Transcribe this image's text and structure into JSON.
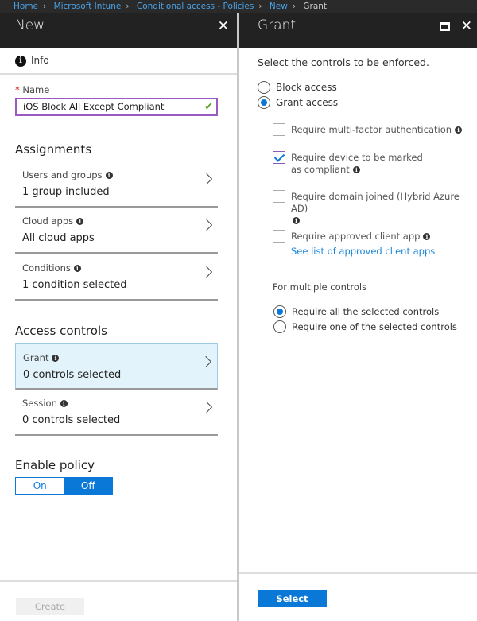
{
  "breadcrumb": [
    "Home",
    "Microsoft Intune",
    "Conditional access - Policies",
    "New",
    "Grant"
  ],
  "left": {
    "title": "New",
    "info_label": "Info",
    "name_label": "Name",
    "required_mark": "*",
    "name_value": "iOS Block All Except Compliant",
    "assignments_heading": "Assignments",
    "assignments": [
      {
        "label": "Users and groups",
        "value": "1 group included"
      },
      {
        "label": "Cloud apps",
        "value": "All cloud apps"
      },
      {
        "label": "Conditions",
        "value": "1 condition selected"
      }
    ],
    "access_heading": "Access controls",
    "access": [
      {
        "label": "Grant",
        "value": "0 controls selected",
        "selected": true
      },
      {
        "label": "Session",
        "value": "0 controls selected",
        "selected": false
      }
    ],
    "enable_heading": "Enable policy",
    "toggle": {
      "on": "On",
      "off": "Off",
      "selected": "Off"
    },
    "create_label": "Create"
  },
  "right": {
    "title": "Grant",
    "intro": "Select the controls to be enforced.",
    "access_options": [
      {
        "label": "Block access",
        "checked": false
      },
      {
        "label": "Grant access",
        "checked": true
      }
    ],
    "controls": [
      {
        "label": "Require multi-factor authentication",
        "checked": false
      },
      {
        "label": "Require device to be marked as compliant",
        "checked": true
      },
      {
        "label": "Require domain joined (Hybrid Azure AD)",
        "checked": false
      },
      {
        "label": "Require approved client app",
        "checked": false
      }
    ],
    "approved_link": "See list of approved client apps",
    "multiple_heading": "For multiple controls",
    "multiple_options": [
      {
        "label": "Require all the selected controls",
        "checked": true
      },
      {
        "label": "Require one of the selected controls",
        "checked": false
      }
    ],
    "select_label": "Select"
  },
  "colors": {
    "accent": "#0a78d7",
    "header": "#222222",
    "selected_row": "#e3f3fb"
  }
}
